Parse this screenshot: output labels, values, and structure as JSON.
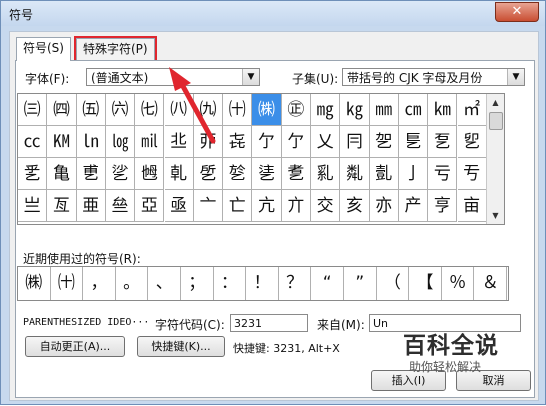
{
  "window": {
    "title": "符号",
    "close_glyph": "✕"
  },
  "tabs": [
    {
      "label": "符号(S)"
    },
    {
      "label": "特殊字符(P)"
    }
  ],
  "font": {
    "label": "字体(F):",
    "value": "(普通文本)"
  },
  "subset": {
    "label": "子集(U):",
    "value": "带括号的 CJK 字母及月份"
  },
  "grid": {
    "rows": [
      [
        "㈢",
        "㈣",
        "㈤",
        "㈥",
        "㈦",
        "㈧",
        "㈨",
        "㈩",
        "㈱",
        "㊣",
        "㎎",
        "㎏",
        "㎜",
        "㎝",
        "㎞",
        "㎡"
      ],
      [
        "㏄",
        "㏎",
        "㏑",
        "㏒",
        "㏕",
        "丠",
        "丣",
        "㐂",
        "亇",
        "亇",
        "乂",
        "冃",
        "乫",
        "乬",
        "乭",
        "乮"
      ],
      [
        "乯",
        "亀",
        "乶",
        "乷",
        "乸",
        "乹",
        "乺",
        "乻",
        "乼",
        "乽",
        "乿",
        "亃",
        "亄",
        "亅",
        "亏",
        "亐"
      ],
      [
        "亗",
        "亙",
        "亜",
        "亝",
        "亞",
        "亟",
        "亠",
        "亡",
        "亢",
        "亣",
        "交",
        "亥",
        "亦",
        "产",
        "亨",
        "亩"
      ]
    ],
    "selected_row": 0,
    "selected_col": 8
  },
  "recent": {
    "label": "近期使用过的符号(R):",
    "items": [
      "㈱",
      "㈩",
      "，",
      "。",
      "、",
      "；",
      "：",
      "！",
      "？",
      "“",
      "”",
      "（",
      "【",
      "％",
      "＆"
    ]
  },
  "char_info": {
    "name": "PARENTHESIZED IDEO···",
    "code_label": "字符代码(C):",
    "code_value": "3231",
    "from_label": "来自(M):",
    "from_value": "Un"
  },
  "buttons": {
    "autocorrect": "自动更正(A)...",
    "shortcut": "快捷键(K)...",
    "shortcut_text": "快捷键: 3231, Alt+X",
    "insert": "插入(I)",
    "cancel": "取消"
  },
  "watermark": {
    "title": "百科全说",
    "subtitle": "助你轻松解决"
  },
  "colors": {
    "highlight_red": "#e0262e",
    "selection_blue": "#3b8ee8"
  }
}
